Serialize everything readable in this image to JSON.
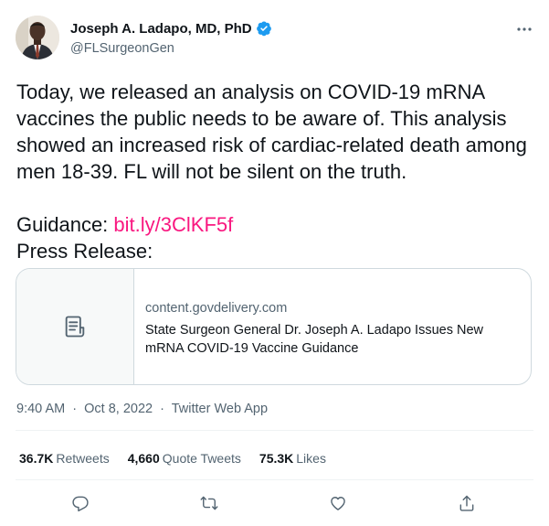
{
  "author": {
    "name": "Joseph A. Ladapo, MD, PhD",
    "handle": "@FLSurgeonGen",
    "verified": true,
    "verified_color": "#1d9bf0"
  },
  "tweet": {
    "paragraph_1": "Today, we released an analysis on COVID-19 mRNA vaccines the public needs to be aware of. This analysis showed an increased risk of cardiac-related death among men 18-39. FL will not be silent on the truth.",
    "guidance_label": "Guidance:",
    "guidance_link": "bit.ly/3ClKF5f",
    "press_release_label": "Press Release:",
    "link_color": "#f91880"
  },
  "card": {
    "domain": "content.govdelivery.com",
    "title": "State Surgeon General Dr. Joseph A. Ladapo Issues New mRNA COVID-19 Vaccine Guidance",
    "icon": "document-icon"
  },
  "meta": {
    "time": "9:40 AM",
    "separator": "·",
    "date": "Oct 8, 2022",
    "source": "Twitter Web App"
  },
  "stats": [
    {
      "count": "36.7K",
      "label": "Retweets"
    },
    {
      "count": "4,660",
      "label": "Quote Tweets"
    },
    {
      "count": "75.3K",
      "label": "Likes"
    }
  ],
  "actions": [
    "reply-icon",
    "retweet-icon",
    "like-icon",
    "share-icon"
  ]
}
